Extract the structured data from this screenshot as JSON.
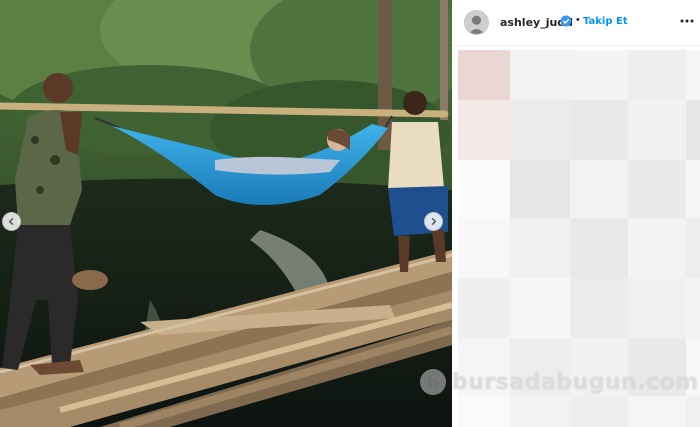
{
  "post": {
    "username": "ashley_judd",
    "separator": "•",
    "follow_label": "Takip Et",
    "verified": true
  },
  "photo": {
    "description_icon": "photo-hammock-river-crossing"
  },
  "watermark": {
    "text": "bursadabugun.com"
  },
  "colors": {
    "follow_blue": "#0095f6",
    "verified_blue": "#3897f0",
    "hammock_blue": "#2a9ad6"
  }
}
